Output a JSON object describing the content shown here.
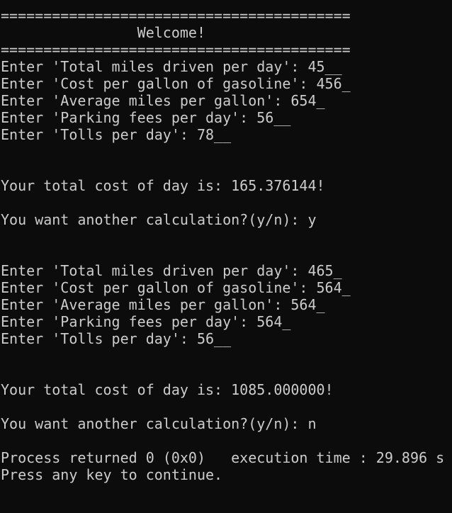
{
  "console": {
    "lines": [
      "=========================================",
      "                Welcome!",
      "=========================================",
      "Enter 'Total miles driven per day': 45__",
      "Enter 'Cost per gallon of gasoline': 456_",
      "Enter 'Average miles per gallon': 654_",
      "Enter 'Parking fees per day': 56__",
      "Enter 'Tolls per day': 78__",
      "",
      "",
      "Your total cost of day is: 165.376144!",
      "",
      "You want another calculation?(y/n): y",
      "",
      "",
      "Enter 'Total miles driven per day': 465_",
      "Enter 'Cost per gallon of gasoline': 564_",
      "Enter 'Average miles per gallon': 564_",
      "Enter 'Parking fees per day': 564_",
      "Enter 'Tolls per day': 56__",
      "",
      "",
      "Your total cost of day is: 1085.000000!",
      "",
      "You want another calculation?(y/n): n",
      "",
      "Process returned 0 (0x0)   execution time : 29.896 s",
      "Press any key to continue."
    ]
  }
}
